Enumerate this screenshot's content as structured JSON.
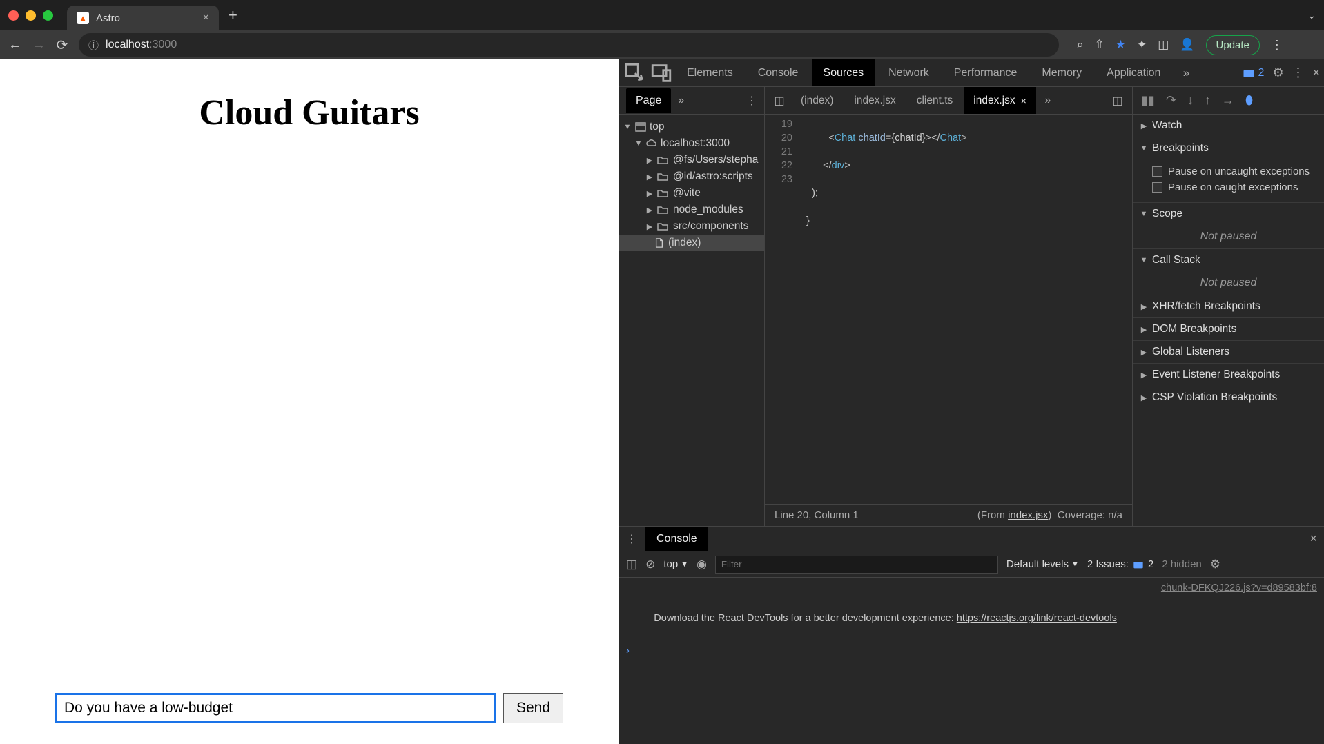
{
  "browser": {
    "tab_title": "Astro",
    "url_host": "localhost",
    "url_port": ":3000",
    "update_label": "Update"
  },
  "page": {
    "heading": "Cloud Guitars",
    "chat_input_value": "Do you have a low-budget",
    "send_label": "Send"
  },
  "devtools": {
    "tabs": [
      "Elements",
      "Console",
      "Sources",
      "Network",
      "Performance",
      "Memory",
      "Application"
    ],
    "active_tab": "Sources",
    "issues_count": "2",
    "nav_pane_tab": "Page",
    "tree": {
      "root": "top",
      "host": "localhost:3000",
      "folders": [
        "@fs/Users/stepha",
        "@id/astro:scripts",
        "@vite",
        "node_modules",
        "src/components"
      ],
      "file": "(index)"
    },
    "editor": {
      "open_files": [
        "(index)",
        "index.jsx",
        "client.ts",
        "index.jsx"
      ],
      "active_file_index": 3,
      "cursor_status": "Line 20, Column 1",
      "from_label": "(From ",
      "from_file": "index.jsx",
      "coverage": "Coverage: n/a",
      "lines": {
        "19": {
          "n": "19"
        },
        "20": {
          "n": "20"
        },
        "21": {
          "n": "21"
        },
        "22": {
          "n": "22"
        },
        "23": {
          "n": "23"
        }
      },
      "code_line19_a": "<",
      "code_line19_tag1": "Chat",
      "code_line19_sp": " ",
      "code_line19_attr": "chatId",
      "code_line19_eq": "=",
      "code_line19_ob": "{",
      "code_line19_val": "chatId",
      "code_line19_cb": "}",
      "code_line19_c": "></",
      "code_line19_tag2": "Chat",
      "code_line19_end": ">",
      "code_line20_a": "</",
      "code_line20_tag": "div",
      "code_line20_end": ">",
      "code_line21": ");",
      "code_line22": "}"
    },
    "debug": {
      "watch": "Watch",
      "breakpoints": "Breakpoints",
      "pause_uncaught": "Pause on uncaught exceptions",
      "pause_caught": "Pause on caught exceptions",
      "scope": "Scope",
      "not_paused": "Not paused",
      "call_stack": "Call Stack",
      "xhr": "XHR/fetch Breakpoints",
      "dom": "DOM Breakpoints",
      "global": "Global Listeners",
      "event": "Event Listener Breakpoints",
      "csp": "CSP Violation Breakpoints"
    }
  },
  "console": {
    "tab": "Console",
    "context": "top",
    "filter_placeholder": "Filter",
    "levels": "Default levels",
    "issues_label": "2 Issues:",
    "issues_count": "2",
    "hidden": "2 hidden",
    "log_source": "chunk-DFKQJ226.js?v=d89583bf:8",
    "log_text": "Download the React DevTools for a better development experience: ",
    "log_link": "https://reactjs.org/link/react-devtools"
  }
}
